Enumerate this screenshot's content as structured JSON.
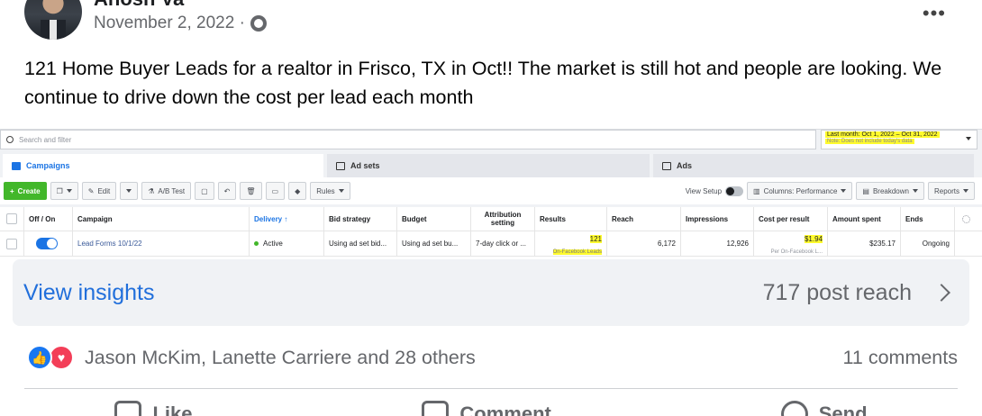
{
  "post": {
    "author": "Anosh Va",
    "date": "November 2, 2022 ·",
    "text": "121 Home Buyer Leads for a realtor in Frisco, TX in Oct!! The market is still hot and people are looking. We continue to drive down the cost per lead each month"
  },
  "ads": {
    "search_placeholder": "Search and filter",
    "date_range": "Last month: Oct 1, 2022 – Oct 31, 2022",
    "date_note": "Note: Does not include today's data",
    "tabs": [
      "Campaigns",
      "Ad sets",
      "Ads"
    ],
    "toolbar": {
      "create": "Create",
      "edit": "Edit",
      "ab_test": "A/B Test",
      "rules": "Rules",
      "view_setup": "View Setup",
      "columns": "Columns: Performance",
      "breakdown": "Breakdown",
      "reports": "Reports"
    },
    "columns": [
      "Off / On",
      "Campaign",
      "Delivery ↑",
      "Bid strategy",
      "Budget",
      "Attribution setting",
      "Results",
      "Reach",
      "Impressions",
      "Cost per result",
      "Amount spent",
      "Ends"
    ],
    "row": {
      "campaign": "Lead Forms 10/1/22",
      "delivery": "Active",
      "bid_strategy": "Using ad set bid...",
      "budget": "Using ad set bu...",
      "attribution": "7-day click or ...",
      "results": "121",
      "results_sub": "On-Facebook Leads",
      "reach": "6,172",
      "impressions": "12,926",
      "cost_per_result": "$1.94",
      "cost_sub": "Per On-Facebook L...",
      "amount_spent": "$235.17",
      "ends": "Ongoing"
    }
  },
  "insights": {
    "view_label": "View insights",
    "reach_label": "717 post reach"
  },
  "engagement": {
    "reactors": "Jason McKim, Lanette Carriere and 28 others",
    "comments": "11 comments"
  },
  "actions": [
    "Like",
    "Comment",
    "Send"
  ]
}
